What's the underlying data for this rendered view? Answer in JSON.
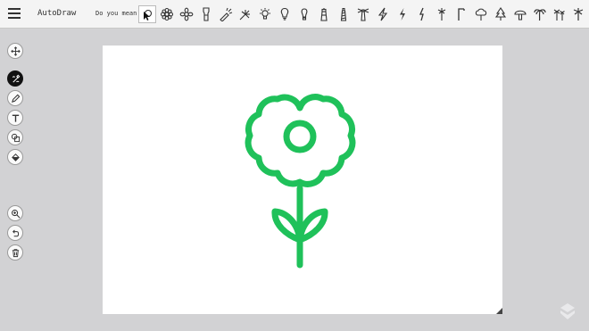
{
  "app": {
    "title": "AutoDraw"
  },
  "suggestions": {
    "label": "Do you mean:",
    "items": [
      "cursor-doodle-icon",
      "flower-icon",
      "flower-outline-icon",
      "flashlight-icon",
      "flashlight-beam-icon",
      "sparkler-icon",
      "light-bulb-rays-icon",
      "light-bulb-icon",
      "light-bulb-alt-icon",
      "lighthouse-icon",
      "lighthouse-striped-icon",
      "lighthouse-beam-icon",
      "lightning-bolt-icon",
      "lightning-bolt-alt-icon",
      "lightning-bolt-thin-icon",
      "palm-sprout-icon",
      "street-lamp-icon",
      "tree-round-icon",
      "tree-pine-icon",
      "mushroom-icon",
      "palm-tree-icon",
      "palm-trees-icon",
      "palm-tree-alt-icon"
    ]
  },
  "toolbar": {
    "tools": [
      "move-icon",
      "autodraw-icon",
      "draw-icon",
      "type-icon",
      "shape-icon",
      "fill-icon",
      "zoom-icon",
      "undo-icon",
      "delete-icon"
    ]
  },
  "colors": {
    "drawing": "#1fc15a",
    "topbar": "#f4f4f4",
    "background": "#d2d2d4"
  }
}
